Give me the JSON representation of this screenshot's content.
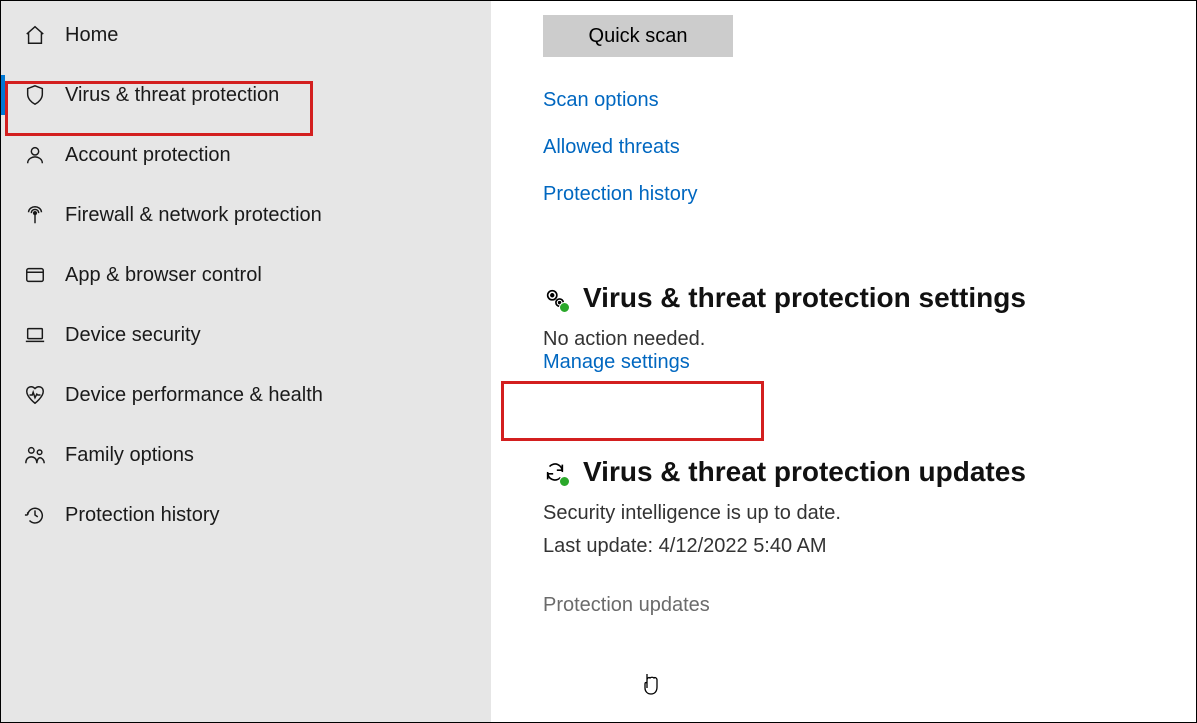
{
  "sidebar": {
    "items": [
      {
        "label": "Home",
        "icon": "home-icon"
      },
      {
        "label": "Virus & threat protection",
        "icon": "shield-icon",
        "active": true
      },
      {
        "label": "Account protection",
        "icon": "person-icon"
      },
      {
        "label": "Firewall & network protection",
        "icon": "antenna-icon"
      },
      {
        "label": "App & browser control",
        "icon": "window-icon"
      },
      {
        "label": "Device security",
        "icon": "laptop-icon"
      },
      {
        "label": "Device performance & health",
        "icon": "heartbeat-icon"
      },
      {
        "label": "Family options",
        "icon": "family-icon"
      },
      {
        "label": "Protection history",
        "icon": "history-icon"
      }
    ]
  },
  "main": {
    "quick_scan_label": "Quick scan",
    "links": {
      "scan_options": "Scan options",
      "allowed_threats": "Allowed threats",
      "protection_history": "Protection history"
    },
    "settings_section": {
      "title": "Virus & threat protection settings",
      "sub": "No action needed.",
      "manage_link": "Manage settings"
    },
    "updates_section": {
      "title": "Virus & threat protection updates",
      "sub": "Security intelligence is up to date.",
      "last_update_label": "Last update: ",
      "last_update_value": "4/12/2022 5:40 AM",
      "protection_updates_link": "Protection updates"
    }
  }
}
